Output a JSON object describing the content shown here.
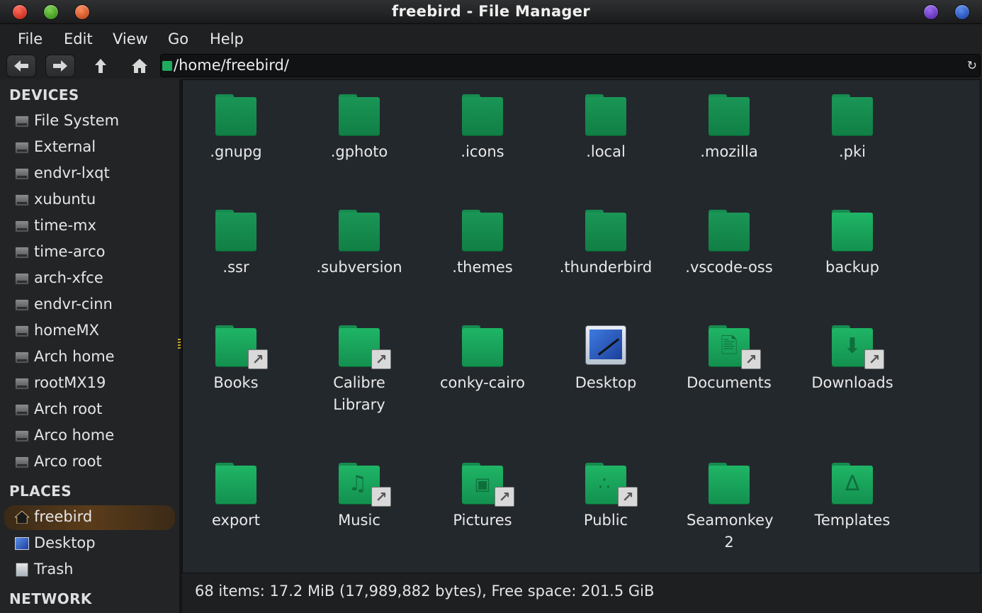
{
  "window": {
    "title": "freebird - File Manager"
  },
  "colors": {
    "accent": "#1fb566",
    "active_place": "#5a3c1a",
    "background": "#23282d"
  },
  "menu": {
    "items": [
      "File",
      "Edit",
      "View",
      "Go",
      "Help"
    ]
  },
  "toolbar": {
    "back_icon": "arrow-left-icon",
    "forward_icon": "arrow-right-icon",
    "up_icon": "arrow-up-icon",
    "home_icon": "home-icon",
    "path": "/home/freebird/",
    "reload_icon": "reload-icon"
  },
  "sidebar": {
    "devices_heading": "DEVICES",
    "devices": [
      "File System",
      "External",
      "endvr-lxqt",
      "xubuntu",
      "time-mx",
      "time-arco",
      "arch-xfce",
      "endvr-cinn",
      "homeMX",
      "Arch home",
      "rootMX19",
      "Arch root",
      "Arco home",
      "Arco root"
    ],
    "places_heading": "PLACES",
    "places": [
      "freebird",
      "Desktop",
      "Trash"
    ],
    "network_heading": "NETWORK"
  },
  "files": [
    {
      "name": ".gnupg",
      "icon": "folder-icon"
    },
    {
      "name": ".gphoto",
      "icon": "folder-icon"
    },
    {
      "name": ".icons",
      "icon": "folder-icon"
    },
    {
      "name": ".local",
      "icon": "folder-icon"
    },
    {
      "name": ".mozilla",
      "icon": "folder-icon"
    },
    {
      "name": ".pki",
      "icon": "folder-icon"
    },
    {
      "name": ".ssr",
      "icon": "folder-icon"
    },
    {
      "name": ".subversion",
      "icon": "folder-icon"
    },
    {
      "name": ".themes",
      "icon": "folder-icon"
    },
    {
      "name": ".thunderbird",
      "icon": "folder-icon"
    },
    {
      "name": ".vscode-oss",
      "icon": "folder-icon"
    },
    {
      "name": "backup",
      "icon": "folder-icon"
    },
    {
      "name": "Books",
      "icon": "folder-link-icon"
    },
    {
      "name": "Calibre Library",
      "icon": "folder-link-icon"
    },
    {
      "name": "conky-cairo",
      "icon": "folder-icon"
    },
    {
      "name": "Desktop",
      "icon": "desktop-icon"
    },
    {
      "name": "Documents",
      "icon": "documents-folder-link-icon"
    },
    {
      "name": "Downloads",
      "icon": "downloads-folder-link-icon"
    },
    {
      "name": "export",
      "icon": "folder-icon"
    },
    {
      "name": "Music",
      "icon": "music-folder-link-icon"
    },
    {
      "name": "Pictures",
      "icon": "pictures-folder-link-icon"
    },
    {
      "name": "Public",
      "icon": "public-folder-link-icon"
    },
    {
      "name": "Seamonkey 2",
      "icon": "folder-icon"
    },
    {
      "name": "Templates",
      "icon": "templates-folder-icon"
    }
  ],
  "status": {
    "text": "68 items: 17.2 MiB (17,989,882 bytes), Free space: 201.5 GiB"
  }
}
